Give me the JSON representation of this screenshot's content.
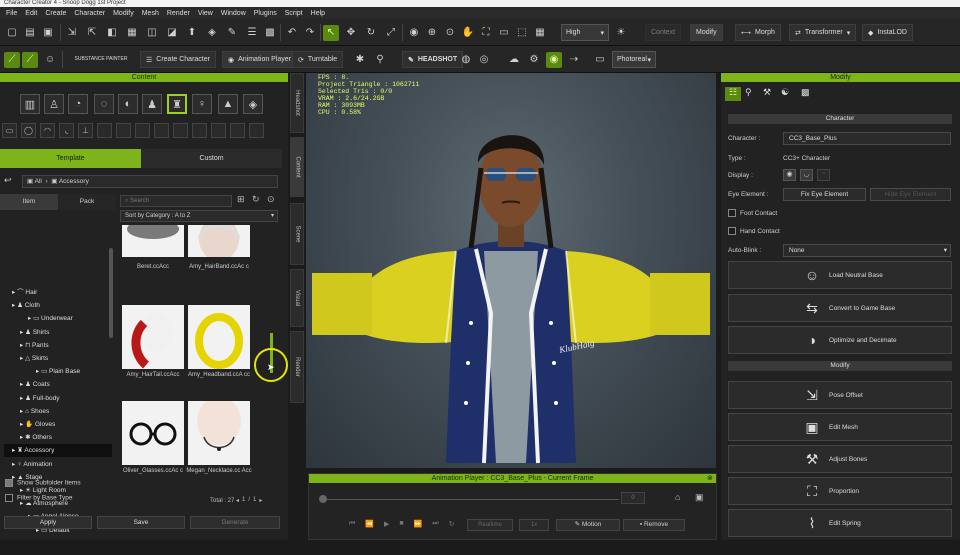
{
  "window": {
    "title": "Character Creator 4 - Snoop Dogg 1st Project"
  },
  "menu": [
    "File",
    "Edit",
    "Create",
    "Character",
    "Modify",
    "Mesh",
    "Render",
    "View",
    "Window",
    "Plugins",
    "Script",
    "Help"
  ],
  "toolbar": {
    "quality": "High",
    "modify_label": "Modify",
    "morph_label": "Morph",
    "transformer_label": "Transformer",
    "instalod_label": "InstaLOD",
    "context_label": "Context",
    "substance_label": "SUBSTANCE PAINTER",
    "create_character_label": "Create Character",
    "animation_player_label": "Animation Player",
    "turntable_label": "Turntable",
    "headshot_label": "HEADSHOT",
    "render_mode": "Photoreal"
  },
  "content": {
    "header": "Content",
    "tabs": {
      "template": "Template",
      "custom": "Custom"
    },
    "breadcrumb": {
      "all": "All",
      "current": "Accessory"
    },
    "subtabs": {
      "item": "Item",
      "pack": "Pack"
    },
    "search_placeholder": "Search",
    "sort": "Sort by Category : A to Z",
    "tree": [
      {
        "label": "Hair",
        "indent": 1
      },
      {
        "label": "Cloth",
        "indent": 1
      },
      {
        "label": "Underwear",
        "indent": 3
      },
      {
        "label": "Shirts",
        "indent": 2
      },
      {
        "label": "Pants",
        "indent": 2
      },
      {
        "label": "Skirts",
        "indent": 2
      },
      {
        "label": "Plain Base",
        "indent": 4
      },
      {
        "label": "Coats",
        "indent": 2
      },
      {
        "label": "Full-body",
        "indent": 2
      },
      {
        "label": "Shoes",
        "indent": 2
      },
      {
        "label": "Gloves",
        "indent": 2
      },
      {
        "label": "Others",
        "indent": 2
      },
      {
        "label": "Accessory",
        "indent": 1
      },
      {
        "label": "Animation",
        "indent": 1
      },
      {
        "label": "Stage",
        "indent": 1
      },
      {
        "label": "Light Room",
        "indent": 2
      },
      {
        "label": "Atmosphere",
        "indent": 2
      },
      {
        "label": "Angel Alonso",
        "indent": 3
      },
      {
        "label": "Default",
        "indent": 4
      }
    ],
    "items": [
      {
        "name": "Beret.ccAcc"
      },
      {
        "name": "Amy_HairBand.ccAc c"
      },
      {
        "name": "Amy_HairTail.ccAcc"
      },
      {
        "name": "Amy_Headband.ccA cc"
      },
      {
        "name": "Oliver_Glasses.ccAc c"
      },
      {
        "name": "Megan_Necklace.cc Acc"
      }
    ],
    "show_subfolder": "Show Subfolder Items",
    "filter_base": "Filter by Base Type",
    "total_label": "Total : 27",
    "page_current": "1",
    "page_sep": "/",
    "page_total": "1",
    "apply_label": "Apply",
    "save_label": "Save",
    "generate_label": "Generate"
  },
  "side_tabs": [
    "Headshot",
    "Content",
    "Scene",
    "Visual",
    "Render"
  ],
  "stats": "FPS : 8.\nProject Triangle : 1062711\nSelected Tris : 0/0\nVRAM : 2.6/24.2GB\nRAM : 3093MB\nCPU : 0.58%",
  "animation_player": {
    "title": "Animation Player : CC3_Base_Plus - Current Frame",
    "frame": "0",
    "realtime": "Realtime",
    "speed": "1x",
    "motion_label": "Motion",
    "remove_label": "Remove"
  },
  "modify": {
    "header": "Modify",
    "character_section": "Character",
    "character_label": "Character :",
    "character_value": "CC3_Base_Plus",
    "type_label": "Type :",
    "type_value": "CC3+ Character",
    "display_label": "Display :",
    "eye_element_label": "Eye Element :",
    "fix_eye": "Fix Eye Element",
    "hide_eye": "Hide Eye Element",
    "foot_contact": "Foot Contact",
    "hand_contact": "Hand Contact",
    "autoblink_label": "Auto-Blink :",
    "autoblink_value": "None",
    "load_neutral": "Load Neutral Base",
    "convert_game": "Convert to Game Base",
    "optimize": "Optimize and Decimate",
    "modify_section": "Modify",
    "pose_offset": "Pose Offset",
    "edit_mesh": "Edit Mesh",
    "adjust_bones": "Adjust Bones",
    "proportion": "Proportion",
    "edit_spring": "Edit Spring"
  },
  "colors": {
    "accent": "#7db419",
    "stats": "#e8ff63"
  },
  "character": {
    "jacket_text": "KlubHaig"
  }
}
